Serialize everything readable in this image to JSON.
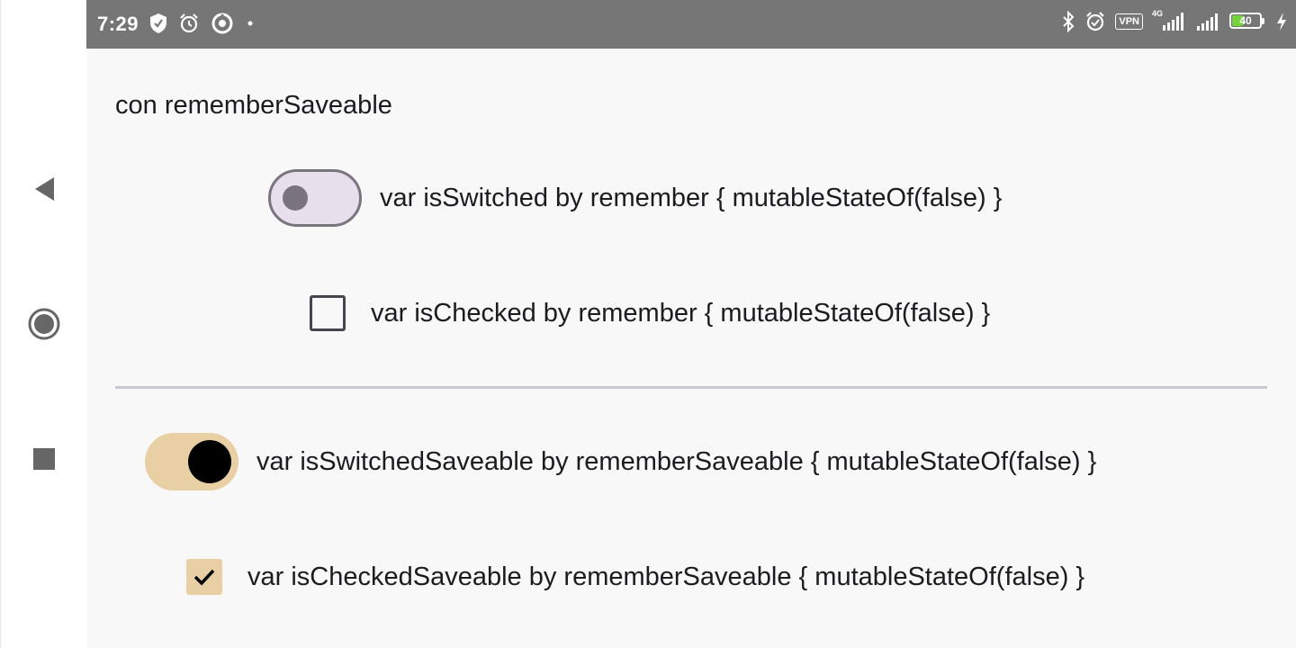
{
  "status_bar": {
    "time": "7:29",
    "left_icons": [
      "shield-icon",
      "alarm-icon",
      "data-saver-icon",
      "dot-icon"
    ],
    "right_icons": [
      "bluetooth-icon",
      "alarm-icon",
      "vpn-icon",
      "signal-4g-icon",
      "signal-icon",
      "battery-icon",
      "charging-icon"
    ],
    "vpn_label": "VPN",
    "network_label": "4G",
    "battery_level": "40",
    "battery_fraction": 0.4,
    "battery_color": "#74d43a"
  },
  "navigation": {
    "back_icon": "back-triangle-icon",
    "home_icon": "home-circle-icon",
    "recents_icon": "recents-square-icon"
  },
  "screen": {
    "title": "con rememberSaveable",
    "remember_section": {
      "switch_label": "var isSwitched by remember { mutableStateOf(false) }",
      "switch_checked": false,
      "checkbox_label": "var isChecked by remember { mutableStateOf(false) }",
      "checkbox_checked": false
    },
    "saveable_section": {
      "switch_label": "var isSwitchedSaveable by rememberSaveable { mutableStateOf(false) }",
      "switch_checked": true,
      "checkbox_label": "var isCheckedSaveable by rememberSaveable { mutableStateOf(false) }",
      "checkbox_checked": true
    }
  },
  "colors": {
    "accent": "#e8cfa4",
    "outline": "#79747e",
    "switch_track_off": "#e7e0ec",
    "status_bar": "#767676"
  }
}
